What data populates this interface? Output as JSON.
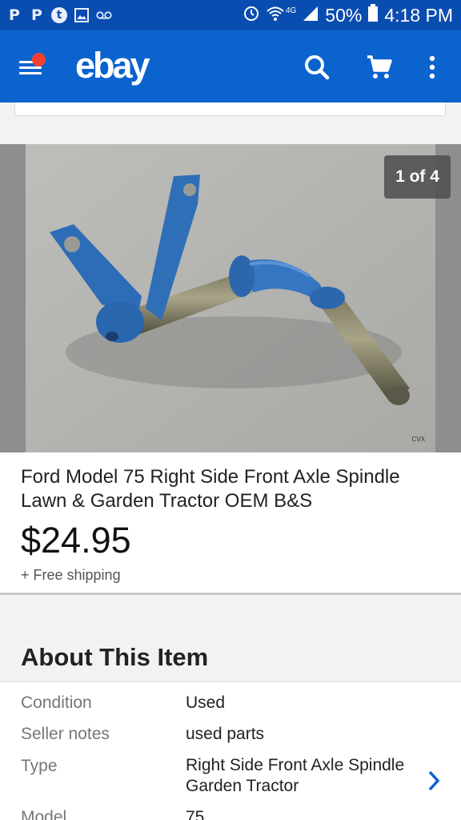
{
  "status_bar": {
    "left_icons": [
      "P",
      "P",
      "t",
      "image-icon",
      "voicemail-icon"
    ],
    "network": "4G",
    "battery": "50%",
    "time": "4:18 PM"
  },
  "app_bar": {
    "logo": "ebay"
  },
  "image": {
    "counter": "1 of 4",
    "watermark": "CVX"
  },
  "item": {
    "title": "Ford Model 75 Right Side Front Axle Spindle Lawn & Garden Tractor OEM B&S",
    "price": "$24.95",
    "shipping": "+ Free shipping"
  },
  "about": {
    "heading": "About This Item",
    "specs": [
      {
        "label": "Condition",
        "value": "Used"
      },
      {
        "label": "Seller notes",
        "value": "used parts"
      },
      {
        "label": "Type",
        "value": "Right Side Front Axle Spindle Garden Tractor"
      },
      {
        "label": "Model",
        "value": "75"
      }
    ]
  },
  "colors": {
    "status_bar": "#0a4db1",
    "app_bar": "#0b63ce",
    "notification_dot": "#f4412f",
    "chevron": "#0b63ce"
  }
}
